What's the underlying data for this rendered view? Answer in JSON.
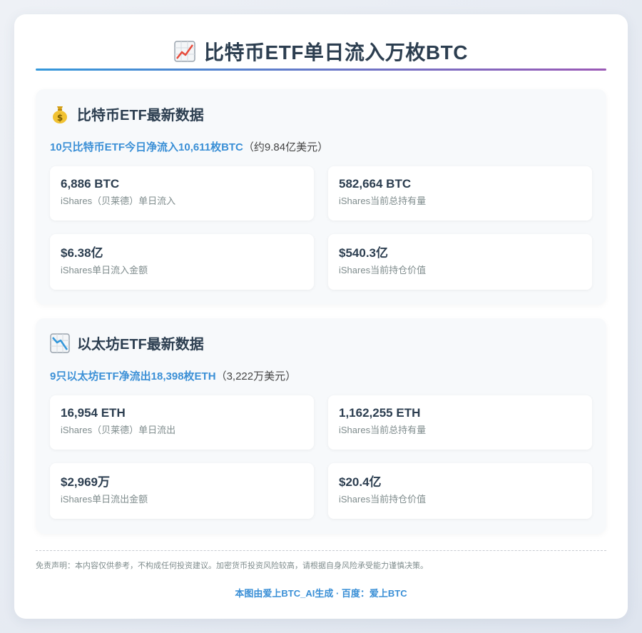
{
  "header": {
    "title": "比特币ETF单日流入万枚BTC",
    "title_icon": "chart-increasing-icon"
  },
  "btc": {
    "heading": "比特币ETF最新数据",
    "heading_icon": "money-bag-icon",
    "summary_highlight": "10只比特币ETF今日净流入10,611枚BTC",
    "summary_note": "（约9.84亿美元）",
    "tiles": [
      {
        "value": "6,886 BTC",
        "label": "iShares（贝莱德）单日流入"
      },
      {
        "value": "582,664 BTC",
        "label": "iShares当前总持有量"
      },
      {
        "value": "$6.38亿",
        "label": "iShares单日流入金额"
      },
      {
        "value": "$540.3亿",
        "label": "iShares当前持仓价值"
      }
    ]
  },
  "eth": {
    "heading": "以太坊ETF最新数据",
    "heading_icon": "chart-decreasing-icon",
    "summary_highlight": "9只以太坊ETF净流出18,398枚ETH",
    "summary_note": "（3,222万美元）",
    "tiles": [
      {
        "value": "16,954 ETH",
        "label": "iShares（贝莱德）单日流出"
      },
      {
        "value": "1,162,255 ETH",
        "label": "iShares当前总持有量"
      },
      {
        "value": "$2,969万",
        "label": "iShares单日流出金额"
      },
      {
        "value": "$20.4亿",
        "label": "iShares当前持仓价值"
      }
    ]
  },
  "footer": {
    "disclaimer": "免责声明：本内容仅供参考，不构成任何投资建议。加密货币投资风险较高，请根据自身风险承受能力谨慎决策。",
    "credit": "本图由爱上BTC_AI生成 · 百度：爱上BTC"
  },
  "colors": {
    "accent": "#3a8fd6",
    "rule_start": "#3498db",
    "rule_end": "#9b59b6"
  }
}
